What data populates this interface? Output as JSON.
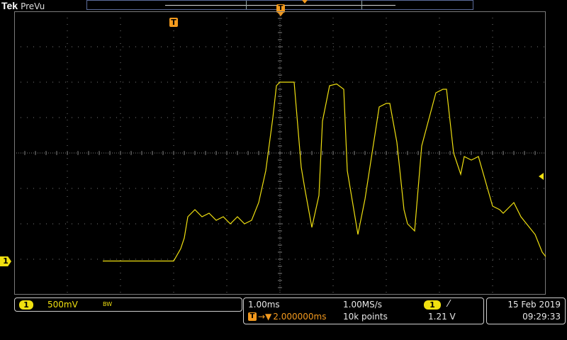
{
  "header": {
    "brand": "Tek",
    "mode": "PreVu"
  },
  "markers": {
    "trigger": "T",
    "channel": "1"
  },
  "channel": {
    "number": "1",
    "scale": "500mV",
    "bandwidth_icon": "BW",
    "color": "#f0e010"
  },
  "horizontal": {
    "timebase": "1.00ms",
    "sample_rate": "1.00MS/s",
    "trigger_delay": "2.000000ms",
    "record_length": "10k points",
    "delay_arrow": "→▼"
  },
  "trigger": {
    "source": "1",
    "slope_icon": "rising-edge-icon",
    "slope_glyph": "⁄",
    "level": "1.21 V",
    "color": "#f39a1e"
  },
  "datetime": {
    "date": "15 Feb 2019",
    "time": "09:29:33"
  },
  "colors": {
    "background": "#000000",
    "grid": "#7a7a7a",
    "trace": "#f0e010",
    "accent": "#f39a1e",
    "frame": "#5b6b9a"
  },
  "chart_data": {
    "type": "line",
    "x": [
      -2.5,
      -1.5,
      -1.4,
      -1.35,
      -1.3,
      -1.2,
      -1.1,
      -1.0,
      -0.9,
      -0.8,
      -0.7,
      -0.6,
      -0.5,
      -0.4,
      -0.3,
      -0.2,
      -0.1,
      -0.05,
      0.0,
      0.1,
      0.2,
      0.3,
      0.35,
      0.45,
      0.55,
      0.6,
      0.7,
      0.8,
      0.9,
      0.95,
      1.1,
      1.2,
      1.4,
      1.5,
      1.55,
      1.65,
      1.75,
      1.8,
      1.9,
      2.0,
      2.2,
      2.3,
      2.35,
      2.45,
      2.55,
      2.6,
      2.7,
      2.8,
      3.0,
      3.1,
      3.15,
      3.3,
      3.4,
      3.6,
      3.7,
      3.8,
      3.9,
      4.0,
      4.2,
      4.3,
      4.5,
      5.0
    ],
    "y": [
      -3.05,
      -3.05,
      -2.7,
      -2.4,
      -1.8,
      -1.6,
      -1.8,
      -1.7,
      -1.9,
      -1.8,
      -2.0,
      -1.8,
      -2.0,
      -1.9,
      -1.4,
      -0.5,
      1.0,
      1.9,
      2.0,
      2.0,
      2.0,
      -0.4,
      -1.0,
      -2.1,
      -1.2,
      0.9,
      1.9,
      1.95,
      1.8,
      -0.5,
      -2.3,
      -1.3,
      1.3,
      1.4,
      1.4,
      0.3,
      -1.6,
      -2.0,
      -2.2,
      0.2,
      1.7,
      1.8,
      1.8,
      0.0,
      -0.6,
      -0.1,
      -0.2,
      -0.1,
      -1.5,
      -1.6,
      -1.7,
      -1.4,
      -1.8,
      -2.3,
      -2.8,
      -3.05,
      -3.05,
      -3.05,
      -3.05,
      -3.05,
      -3.05,
      -3.05
    ],
    "xlabel": "",
    "ylabel": "",
    "xlim": [
      -3.75,
      3.75
    ],
    "ylim": [
      -4,
      4
    ],
    "grid": true
  }
}
